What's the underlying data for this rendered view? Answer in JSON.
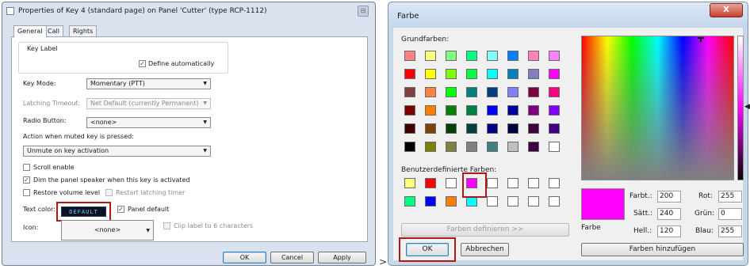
{
  "left_dialog": {
    "title": "Properties of Key 4 (standard page) on Panel 'Cutter' (type RCP-1112)",
    "tabs": [
      "General",
      "Call",
      "Rights"
    ],
    "key_label_group": "Key Label",
    "define_automatically": "Define automatically",
    "key_mode_label": "Key Mode:",
    "key_mode_value": "Momentary (PTT)",
    "latching_timeout_label": "Latching Timeout:",
    "latching_timeout_value": "Net Default (currently Permanent)",
    "radio_button_label": "Radio Button:",
    "radio_button_value": "<none>",
    "muted_action_label": "Action when muted key is pressed:",
    "muted_action_value": "Unmute on key activation",
    "scroll_enable": "Scroll enable",
    "dim_speaker": "Dim the panel speaker when this key is activated",
    "restore_volume": "Restore volume level",
    "restart_latching": "Restart latching timer",
    "text_color_label": "Text color:",
    "text_color_button": "DEFAULT",
    "panel_default": "Panel default",
    "icon_label": "Icon:",
    "icon_value": "<none>",
    "clip_label": "Clip label to 6 characters",
    "ok": "OK",
    "cancel": "Cancel",
    "apply": "Apply",
    "close_glyph": "⊟"
  },
  "separator": ">",
  "right_dialog": {
    "title": "Farbe",
    "close_glyph": "X",
    "basic_colors_label": "Grundfarben:",
    "custom_colors_label": "Benutzerdefinierte Farben:",
    "define_colors_button": "Farben definieren >>",
    "ok": "OK",
    "cancel": "Abbrechen",
    "preview_label": "Farbe",
    "hue_label": "Farbt.:",
    "hue_value": "200",
    "sat_label": "Sätt.:",
    "sat_value": "240",
    "lum_label": "Hell.:",
    "lum_value": "120",
    "red_label": "Rot:",
    "red_value": "255",
    "green_label": "Grün:",
    "green_value": "0",
    "blue_label": "Blau:",
    "blue_value": "255",
    "add_colors_button": "Farben hinzufügen",
    "selected_color": "#ff00ff",
    "basic_colors": [
      [
        "#ff8080",
        "#ffff80",
        "#80ff80",
        "#00ff80",
        "#80ffff",
        "#0080ff",
        "#ff80c0",
        "#ff80ff"
      ],
      [
        "#ff0000",
        "#ffff00",
        "#80ff00",
        "#00ff40",
        "#00ffff",
        "#0080c0",
        "#8080c0",
        "#ff00ff"
      ],
      [
        "#804040",
        "#ff8040",
        "#00ff00",
        "#008080",
        "#004080",
        "#8080ff",
        "#800040",
        "#ff0080"
      ],
      [
        "#800000",
        "#ff8000",
        "#008000",
        "#008040",
        "#0000ff",
        "#0000a0",
        "#800080",
        "#8000ff"
      ],
      [
        "#400000",
        "#804000",
        "#004000",
        "#004040",
        "#000080",
        "#000040",
        "#400040",
        "#400080"
      ],
      [
        "#000000",
        "#808000",
        "#808040",
        "#808080",
        "#408080",
        "#c0c0c0",
        "#400040",
        "#ffffff"
      ]
    ],
    "custom_colors": [
      [
        "#ffff80",
        "#ff0000",
        "#ffffff",
        "#ff00ff",
        "#ffffff",
        "#ffffff",
        "#ffffff",
        "#ffffff"
      ],
      [
        "#00ff80",
        "#0000ff",
        "#ff8000",
        "#00ffff",
        "#ffffff",
        "#ffffff",
        "#ffffff",
        "#ffffff"
      ]
    ]
  }
}
